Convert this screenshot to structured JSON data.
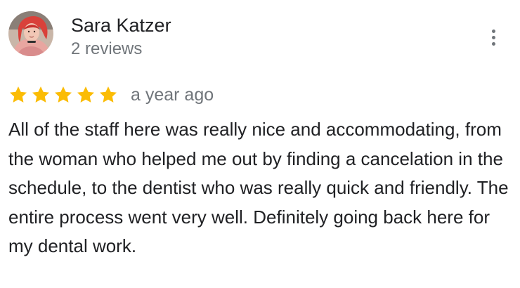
{
  "review": {
    "reviewer_name": "Sara Katzer",
    "review_count": "2 reviews",
    "rating": 5,
    "max_rating": 5,
    "date": "a year ago",
    "text": "All of the staff here was really nice and accommodating, from the woman who helped me out by finding a cancelation in the schedule, to the dentist who was really quick and friendly. The entire process went very well. Definitely going back here for my dental work.",
    "star_color": "#fbbc04",
    "icons": {
      "avatar": "avatar-photo",
      "menu": "more-vertical-icon",
      "star": "star-icon"
    }
  }
}
